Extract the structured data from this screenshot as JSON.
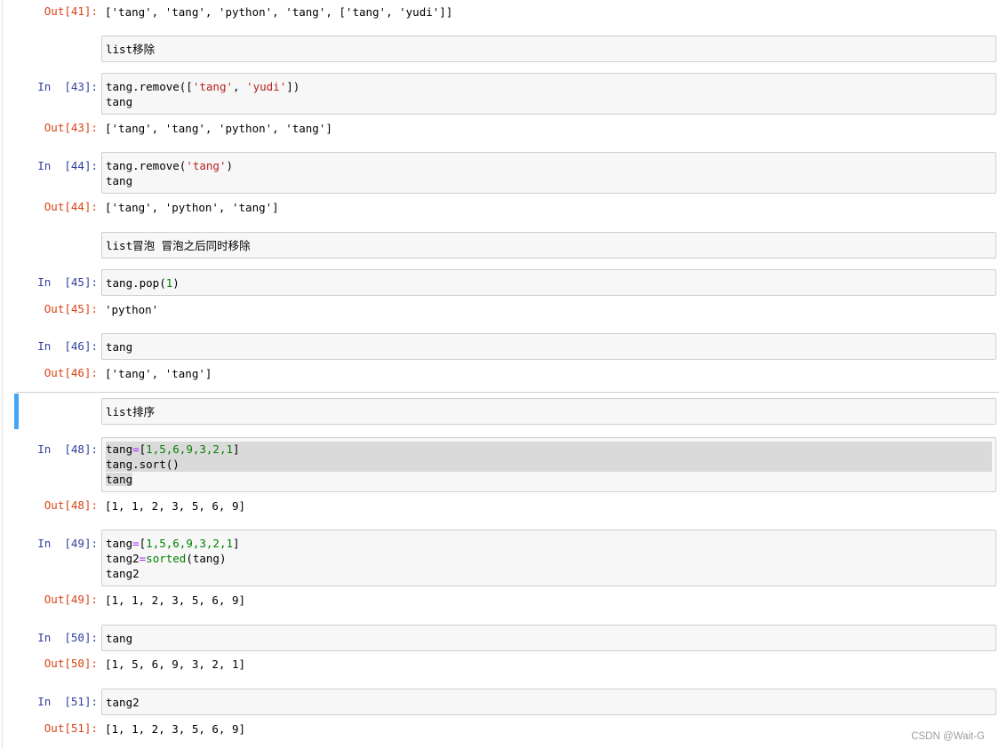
{
  "cells": {
    "out41": {
      "prompt": "Out[41]:",
      "text": "['tang', 'tang', 'python', 'tang', ['tang', 'yudi']]"
    },
    "md_remove": {
      "text": "list移除"
    },
    "in43": {
      "prompt": "In  [43]:",
      "l1a": "tang.remove([",
      "l1s1": "'tang'",
      "l1c": ", ",
      "l1s2": "'yudi'",
      "l1e": "])",
      "l2": "tang"
    },
    "out43": {
      "prompt": "Out[43]:",
      "text": "['tang', 'tang', 'python', 'tang']"
    },
    "in44": {
      "prompt": "In  [44]:",
      "l1a": "tang.remove(",
      "l1s": "'tang'",
      "l1e": ")",
      "l2": "tang"
    },
    "out44": {
      "prompt": "Out[44]:",
      "text": "['tang', 'python', 'tang']"
    },
    "md_pop": {
      "text": "list冒泡 冒泡之后同时移除"
    },
    "in45": {
      "prompt": "In  [45]:",
      "l1a": "tang.pop(",
      "l1n": "1",
      "l1e": ")"
    },
    "out45": {
      "prompt": "Out[45]:",
      "text": "'python'"
    },
    "in46": {
      "prompt": "In  [46]:",
      "l1": "tang"
    },
    "out46": {
      "prompt": "Out[46]:",
      "text": "['tang', 'tang']"
    },
    "md_sort": {
      "text": "list排序"
    },
    "in48": {
      "prompt": "In  [48]:",
      "l1a": "tang",
      "l1o": "=",
      "l1b": "[",
      "l1n": "1,5,6,9,3,2,1",
      "l1e": "]",
      "l2": "tang.sort()",
      "l3": "tang"
    },
    "out48": {
      "prompt": "Out[48]:",
      "text": "[1, 1, 2, 3, 5, 6, 9]"
    },
    "in49": {
      "prompt": "In  [49]:",
      "l1a": "tang",
      "l1o": "=",
      "l1b": "[",
      "l1n": "1,5,6,9,3,2,1",
      "l1e": "]",
      "l2a": "tang2",
      "l2o": "=",
      "l2f": "sorted",
      "l2e": "(tang)",
      "l3": "tang2"
    },
    "out49": {
      "prompt": "Out[49]:",
      "text": "[1, 1, 2, 3, 5, 6, 9]"
    },
    "in50": {
      "prompt": "In  [50]:",
      "l1": "tang"
    },
    "out50": {
      "prompt": "Out[50]:",
      "text": "[1, 5, 6, 9, 3, 2, 1]"
    },
    "in51": {
      "prompt": "In  [51]:",
      "l1": "tang2"
    },
    "out51": {
      "prompt": "Out[51]:",
      "text": "[1, 1, 2, 3, 5, 6, 9]"
    }
  },
  "watermark": "CSDN @Wait-G",
  "colors": {
    "in_prompt": "#303f9f",
    "out_prompt": "#d84315",
    "string": "#ba2121",
    "number": "#008000",
    "selected_bar": "#42a5f5"
  }
}
